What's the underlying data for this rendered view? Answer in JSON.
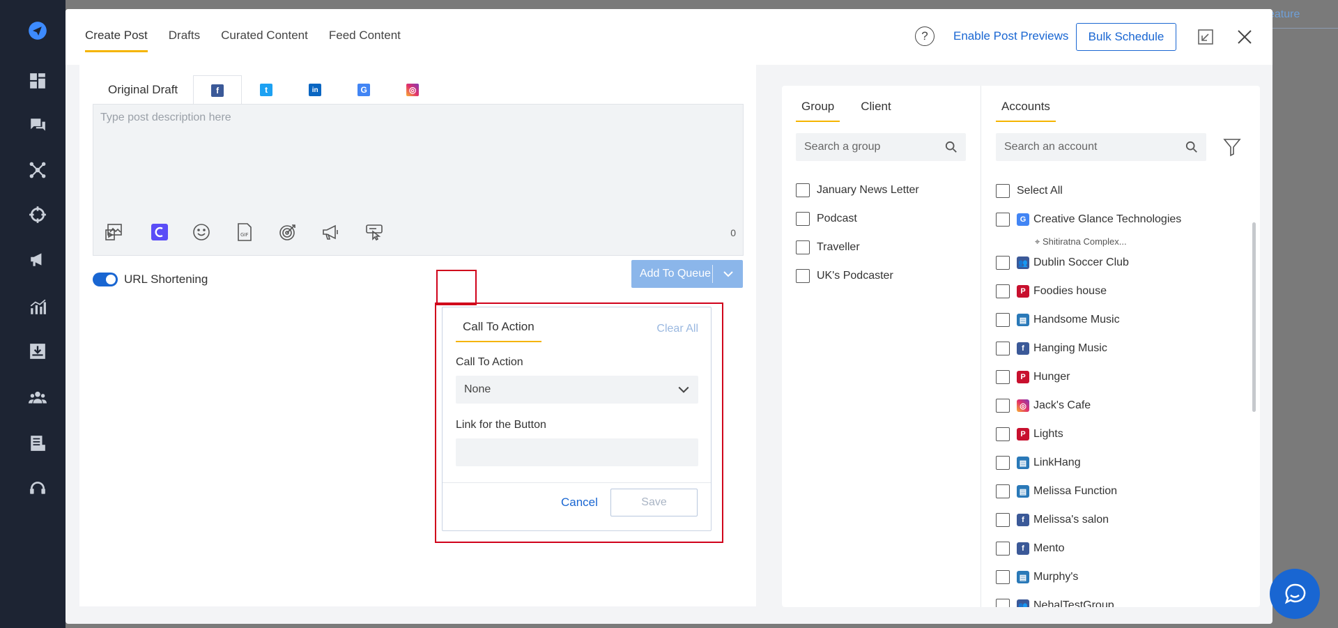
{
  "background": {
    "feature_text": "eature"
  },
  "header": {
    "tabs": [
      {
        "label": "Create Post",
        "active": true
      },
      {
        "label": "Drafts",
        "active": false
      },
      {
        "label": "Curated Content",
        "active": false
      },
      {
        "label": "Feed Content",
        "active": false
      }
    ],
    "help_glyph": "?",
    "enable_previews": "Enable Post Previews",
    "bulk_schedule": "Bulk Schedule"
  },
  "composer": {
    "channel_tabs": [
      {
        "label": "Original Draft"
      },
      {
        "icon": "facebook-icon",
        "glyph": "f",
        "color": "#3b5998"
      },
      {
        "icon": "twitter-icon",
        "glyph": "t",
        "color": "#1da1f2"
      },
      {
        "icon": "linkedin-icon",
        "glyph": "in",
        "color": "#0a66c2"
      },
      {
        "icon": "google-business-icon",
        "glyph": "G",
        "color": "#4285f4"
      },
      {
        "icon": "instagram-icon",
        "glyph": "◎",
        "color": "#e1306c"
      }
    ],
    "placeholder": "Type post description here",
    "char_count": "0",
    "url_shortening": "URL Shortening",
    "add_to_queue": "Add To Queue"
  },
  "cta_popover": {
    "tab": "Call To Action",
    "clear_all": "Clear All",
    "call_to_action_label": "Call To Action",
    "call_to_action_value": "None",
    "link_label": "Link for the Button",
    "cancel": "Cancel",
    "save": "Save"
  },
  "groups": {
    "tabs": [
      {
        "label": "Group",
        "active": true
      },
      {
        "label": "Client",
        "active": false
      }
    ],
    "search_placeholder": "Search a group",
    "items": [
      "January News Letter",
      "Podcast",
      "Traveller",
      "UK's Podcaster"
    ]
  },
  "accounts": {
    "tab": "Accounts",
    "search_placeholder": "Search an account",
    "select_all": "Select All",
    "items": [
      {
        "name": "Creative Glance Technologies",
        "platform": "google-business",
        "sub": "Shitiratna Complex..."
      },
      {
        "name": "Dublin Soccer Club",
        "platform": "facebook-group"
      },
      {
        "name": "Foodies house",
        "platform": "pinterest"
      },
      {
        "name": "Handsome Music",
        "platform": "linkedin-page"
      },
      {
        "name": "Hanging Music",
        "platform": "facebook"
      },
      {
        "name": "Hunger",
        "platform": "pinterest"
      },
      {
        "name": "Jack's Cafe",
        "platform": "instagram"
      },
      {
        "name": "Lights",
        "platform": "pinterest"
      },
      {
        "name": "LinkHang",
        "platform": "linkedin-page"
      },
      {
        "name": "Melissa Function",
        "platform": "linkedin-page"
      },
      {
        "name": "Melissa's salon",
        "platform": "facebook"
      },
      {
        "name": "Mento",
        "platform": "facebook"
      },
      {
        "name": "Murphy's",
        "platform": "linkedin-page"
      },
      {
        "name": "NehalTestGroup",
        "platform": "facebook-group"
      }
    ]
  }
}
